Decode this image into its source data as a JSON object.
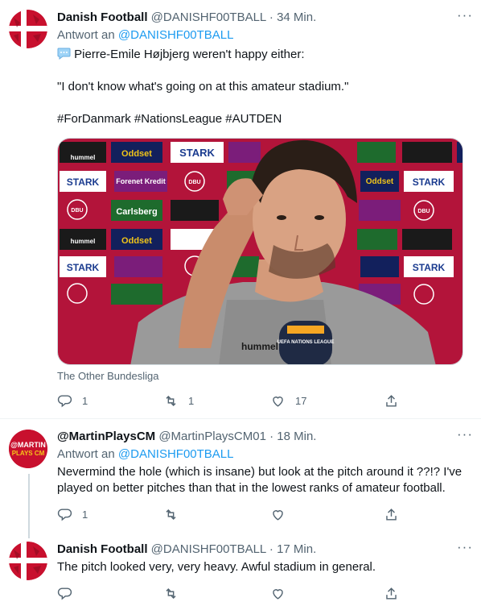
{
  "tweets": [
    {
      "name": "Danish Football",
      "handle": "@DANISHF00TBALL",
      "separator": "·",
      "time": "34 Min.",
      "replying_prefix": "Antwort an",
      "replying_to": "@DANISHF00TBALL",
      "line1": "Pierre-Emile Højbjerg weren't happy either:",
      "line2": "\"I don't know what's going on at this amateur stadium.\"",
      "hashtags": "#ForDanmark #NationsLeague #AUTDEN",
      "media_caption": "The Other Bundesliga",
      "replies": "1",
      "retweets": "1",
      "likes": "17"
    },
    {
      "name": "@MartinPlaysCM",
      "handle": "@MartinPlaysCM01",
      "separator": "·",
      "time": "18 Min.",
      "replying_prefix": "Antwort an",
      "replying_to": "@DANISHF00TBALL",
      "text": "Nevermind the hole (which is insane) but look at the pitch around it ??!? I've played on better pitches than that in the lowest ranks of amateur football.",
      "replies": "1",
      "avatar_text_1": "@MARTIN",
      "avatar_text_2": "PLAYS CM"
    },
    {
      "name": "Danish Football",
      "handle": "@DANISHF00TBALL",
      "separator": "·",
      "time": "17 Min.",
      "text": "The pitch looked very, very heavy. Awful stadium in general."
    }
  ],
  "media_sponsors": {
    "stark": "STARK",
    "oddset": "Oddset",
    "carlsberg": "Carlsberg",
    "hummel": "hummel",
    "forenet": "Forenet Kredit",
    "dbu": "DBU",
    "uefa": "UEFA NATIONS LEAGUE",
    "shirt": "hummel"
  },
  "colors": {
    "link": "#1d9bf0",
    "secondary": "#536471",
    "danish_red": "#c8102e"
  }
}
